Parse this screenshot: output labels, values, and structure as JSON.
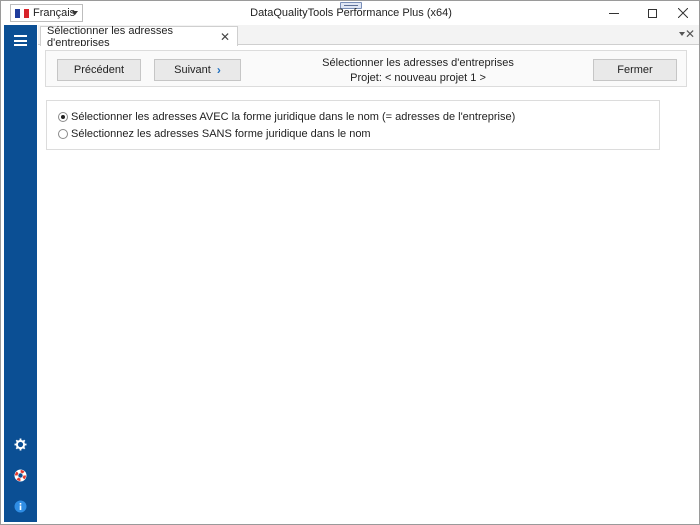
{
  "window": {
    "title": "DataQualityTools Performance Plus (x64)",
    "language": "Français"
  },
  "tab": {
    "label": "Sélectionner les adresses d'entreprises",
    "close_glyph": "✕"
  },
  "toolbar": {
    "prev_label": "Précédent",
    "next_label": "Suivant",
    "close_label": "Fermer",
    "title": "Sélectionner les adresses d'entreprises",
    "project": "Projet: < nouveau projet 1 >"
  },
  "options": [
    {
      "label": "Sélectionner les adresses AVEC la forme juridique dans le nom (= adresses de l'entreprise)",
      "checked": true
    },
    {
      "label": "Sélectionnez les adresses SANS forme juridique dans le nom",
      "checked": false
    }
  ],
  "sidebar": {
    "icons": [
      "menu-icon",
      "gear-icon",
      "help-icon",
      "info-icon"
    ]
  },
  "colors": {
    "sidebar": "#0b4f94",
    "accent": "#1e6fc0"
  }
}
